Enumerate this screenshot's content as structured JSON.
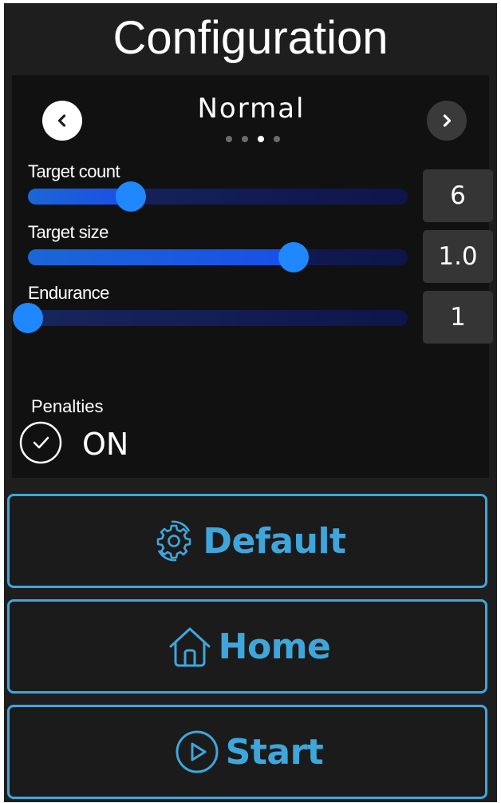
{
  "title": "Configuration",
  "preset": {
    "name": "Normal",
    "page_count": 4,
    "active_page": 3
  },
  "sliders": [
    {
      "label": "Target count",
      "value": "6",
      "fraction": 0.27
    },
    {
      "label": "Target size",
      "value": "1.0",
      "fraction": 0.7
    },
    {
      "label": "Endurance",
      "value": "1",
      "fraction": 0.0
    }
  ],
  "penalties": {
    "label": "Penalties",
    "state": "ON",
    "checked": true
  },
  "buttons": {
    "default_label": "Default",
    "home_label": "Home",
    "start_label": "Start"
  },
  "colors": {
    "accent": "#3fa6dc",
    "thumb": "#1f88ff",
    "background": "#1e1e1e",
    "panel": "#111111"
  },
  "icons": {
    "prev": "chevron-left-icon",
    "next": "chevron-right-icon",
    "toggle": "check-circle-icon",
    "default": "gear-icon",
    "home": "home-icon",
    "start": "play-icon"
  }
}
